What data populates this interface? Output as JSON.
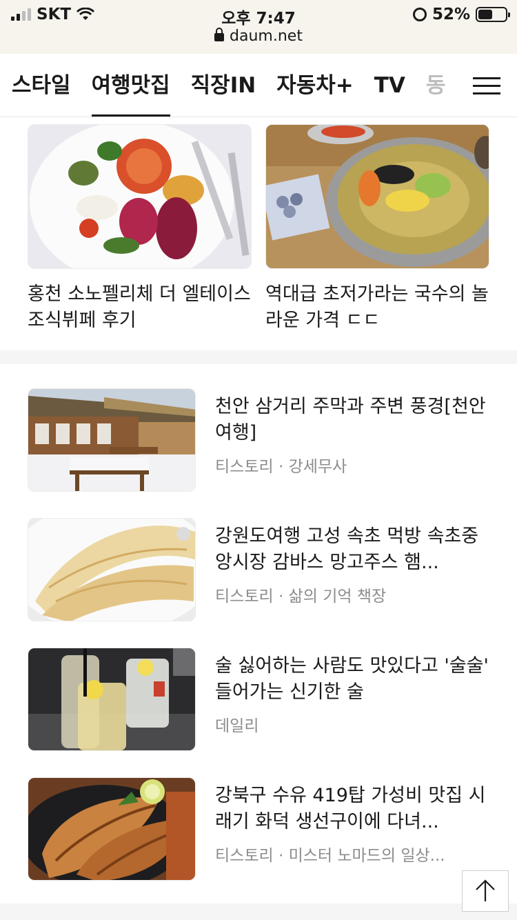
{
  "status_bar": {
    "carrier": "SKT",
    "time": "오후 7:47",
    "url": "daum.net",
    "battery": "52%",
    "battery_level": 0.52
  },
  "tabs": [
    {
      "label": "스타일"
    },
    {
      "label": "여행맛집"
    },
    {
      "label": "직장IN"
    },
    {
      "label": "자동차+"
    },
    {
      "label": "TV"
    },
    {
      "label": "동"
    }
  ],
  "active_tab": 1,
  "grid_cards": [
    {
      "title": "홍천 소노펠리체 더 엘테이스 조식뷔페 후기",
      "image": "breakfast-buffet-plate"
    },
    {
      "title": "역대급 초저가라는 국수의 놀라운 가격 ㄷㄷ",
      "image": "cold-noodle-bowl"
    }
  ],
  "articles": [
    {
      "title": "천안 삼거리 주막과 주변 풍경[천안여행]",
      "source": "티스토리 · 강세무사",
      "image": "hanok-snow"
    },
    {
      "title": "강원도여행 고성 속초 먹방 속초중앙시장 감바스 망고주스 햄...",
      "source": "티스토리 · 삶의 기억 책장",
      "image": "sliced-fish"
    },
    {
      "title": "술 싫어하는 사람도 맛있다고 '술술' 들어가는 신기한 술",
      "source": "데일리",
      "image": "lemon-drinks"
    },
    {
      "title": "강북구 수유 419탑 가성비 맛집 시래기 화덕 생선구이에 다녀...",
      "source": "티스토리 · 미스터 노마드의 일상...",
      "image": "grilled-mackerel"
    }
  ],
  "icons": {
    "lock": "lock-icon",
    "wifi": "wifi-icon",
    "alarm": "alarm-icon",
    "menu": "hamburger-menu-icon",
    "scroll_top": "arrow-up-icon"
  }
}
